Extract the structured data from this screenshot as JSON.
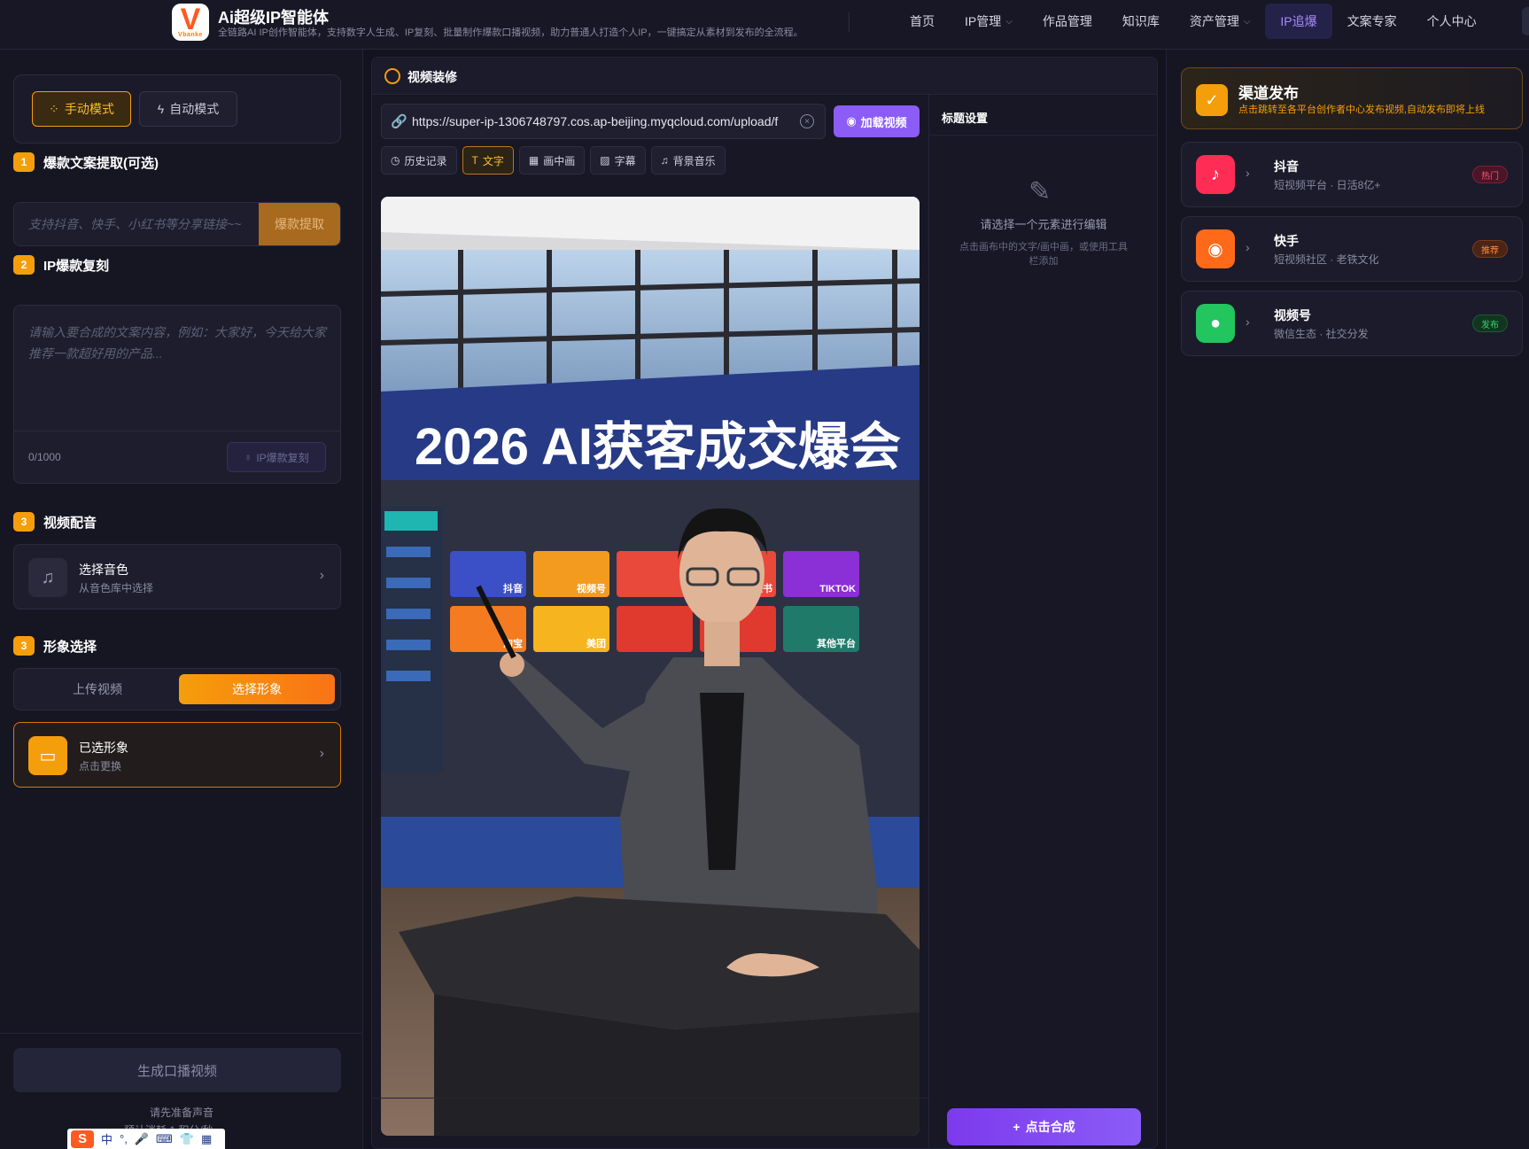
{
  "header": {
    "logo_letter": "V",
    "logo_text": "Vbanke",
    "title": "Ai超级IP智能体",
    "subtitle": "全链路AI IP创作智能体，支持数字人生成、IP复刻、批量制作爆款口播视频，助力普通人打造个人IP，一键搞定从素材到发布的全流程。",
    "nav": [
      {
        "label": "首页",
        "has_dropdown": false,
        "active": false
      },
      {
        "label": "IP管理",
        "has_dropdown": true,
        "active": false
      },
      {
        "label": "作品管理",
        "has_dropdown": false,
        "active": false
      },
      {
        "label": "知识库",
        "has_dropdown": false,
        "active": false
      },
      {
        "label": "资产管理",
        "has_dropdown": true,
        "active": false
      },
      {
        "label": "IP追爆",
        "has_dropdown": false,
        "active": true
      },
      {
        "label": "文案专家",
        "has_dropdown": false,
        "active": false
      },
      {
        "label": "个人中心",
        "has_dropdown": false,
        "active": false
      }
    ],
    "accent_color": "#a78bfa"
  },
  "left": {
    "modes": {
      "manual": "手动模式",
      "auto": "自动模式",
      "selected": "manual"
    },
    "section1": {
      "num": "1",
      "title": "爆款文案提取(可选)",
      "placeholder": "支持抖音、快手、小红书等分享链接~~",
      "button": "爆款提取"
    },
    "section2": {
      "num": "2",
      "title": "IP爆款复刻",
      "placeholder": "请输入要合成的文案内容，例如：大家好，今天给大家推荐一款超好用的产品...",
      "count": "0/1000",
      "button": "IP爆款复刻"
    },
    "section3": {
      "num": "3",
      "title": "视频配音",
      "card_title": "选择音色",
      "card_sub": "从音色库中选择"
    },
    "section4": {
      "num": "3",
      "title": "形象选择",
      "tab_upload": "上传视频",
      "tab_choose": "选择形象",
      "selected_tab": "choose",
      "card_title": "已选形象",
      "card_sub": "点击更换"
    },
    "footer": {
      "button": "生成口播视频",
      "hint": "请先准备声音",
      "hint2": "预计消耗 1 积分/秒"
    },
    "accent_color": "#f59e0b"
  },
  "ime": {
    "logo": "S",
    "lang": "中",
    "punct": "°,",
    "mic": "🎤",
    "keyboard": "⌨",
    "shirt": "👕",
    "grid": "▦"
  },
  "center": {
    "title": "视频装修",
    "url": "https://super-ip-1306748797.cos.ap-beijing.myqcloud.com/upload/f",
    "load_button": "加载视频",
    "tools": [
      "历史记录",
      "文字",
      "画中画",
      "字幕",
      "背景音乐"
    ],
    "active_tool": "文字",
    "preview": {
      "banner": "2026 AI获客成交爆会",
      "screen_tiles": [
        {
          "label": "抖音",
          "color": "#3b4fc7"
        },
        {
          "label": "视频号",
          "color": "#f29b1f"
        },
        {
          "label": "",
          "color": "#e8493a"
        },
        {
          "label": "小红书",
          "color": "#e8493a"
        },
        {
          "label": "TIKTOK",
          "color": "#8b2fd6"
        },
        {
          "label": "淘宝",
          "color": "#f47b1f"
        },
        {
          "label": "美团",
          "color": "#f6b51e"
        },
        {
          "label": "",
          "color": "#e0392d"
        },
        {
          "label": "",
          "color": "#e0392d"
        },
        {
          "label": "其他平台",
          "color": "#1f7a6a"
        }
      ]
    },
    "settings": {
      "title": "标题设置",
      "empty_title": "请选择一个元素进行编辑",
      "empty_desc": "点击画布中的文字/画中画，或使用工具栏添加",
      "compose_button": "点击合成"
    }
  },
  "right": {
    "header_title": "渠道发布",
    "header_desc": "点击跳转至各平台创作者中心发布视频,自动发布即将上线",
    "platforms": [
      {
        "name": "抖音",
        "desc": "短视频平台 · 日活8亿+",
        "badge": "热门",
        "icon_color": "#ff2d55",
        "badge_bg": "#4a1526",
        "badge_color": "#ff5577",
        "icon": "♪"
      },
      {
        "name": "快手",
        "desc": "短视频社区 · 老铁文化",
        "badge": "推荐",
        "icon_color": "#ff6a1a",
        "badge_bg": "#4a2414",
        "badge_color": "#ff8a3d",
        "icon": "◉"
      },
      {
        "name": "视频号",
        "desc": "微信生态 · 社交分发",
        "badge": "发布",
        "icon_color": "#22c55e",
        "badge_bg": "#11361f",
        "badge_color": "#34d36e",
        "icon": "●"
      }
    ]
  }
}
